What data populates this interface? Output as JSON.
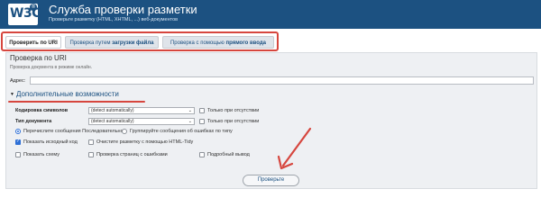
{
  "header": {
    "logo_text": "W3C",
    "logo_mark": "®",
    "title": "Служба проверки разметки",
    "subtitle": "Проверьте разметку (HTML, XHTML, ...) веб-документов"
  },
  "tabs": [
    {
      "label": "Проверить по URI",
      "active": true
    },
    {
      "label_prefix": "Проверка путем ",
      "label_strong": "загрузки файла",
      "active": false
    },
    {
      "label_prefix": "Проверка с помощью ",
      "label_strong": "прямого ввода",
      "active": false
    }
  ],
  "panel": {
    "title": "Проверка по URI",
    "description": "Проверка документа в режиме онлайн.",
    "address_label": "Адрес:",
    "address_value": "",
    "more_options_label": "Дополнительные возможности",
    "encoding": {
      "label": "Кодировка символов",
      "selected": "(detect automatically)",
      "fallback_label": "Только при отсутствии",
      "fallback_checked": false
    },
    "doctype": {
      "label": "Тип документа",
      "selected": "(detect automatically)",
      "fallback_label": "Только при отсутствии",
      "fallback_checked": false
    },
    "grouping": {
      "option1": "Перечислите сообщения Последовательно",
      "option2": "Группируйте сообщения об ошибках по типу",
      "selected": 1
    },
    "checkboxes": [
      {
        "label": "Показать исходный код",
        "checked": true
      },
      {
        "label": "Очистите разметку с помощью HTML-Tidy",
        "checked": false
      },
      {
        "label": "Показать схему",
        "checked": false
      },
      {
        "label": "Проверка страниц с ошибками",
        "checked": false
      },
      {
        "label": "Подробный вывод",
        "checked": false
      }
    ]
  },
  "submit_label": "Проверьте",
  "colors": {
    "header_bg": "#1c5181",
    "highlight_red": "#d6463e",
    "panel_bg": "#eef0f3"
  }
}
